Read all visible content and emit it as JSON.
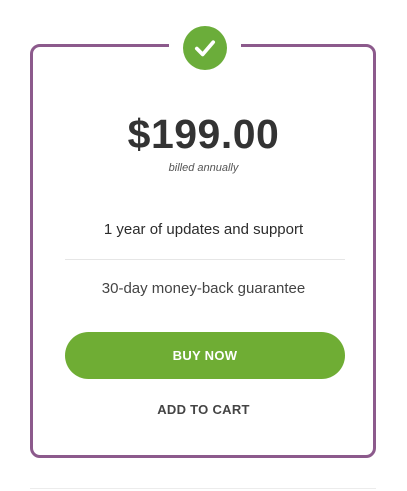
{
  "pricing": {
    "price": "$199.00",
    "billing_note": "billed annually",
    "features": [
      "1 year of updates and support",
      "30-day money-back guarantee"
    ],
    "buy_label": "BUY NOW",
    "cart_label": "ADD TO CART",
    "icon": "checkmark-icon"
  },
  "colors": {
    "card_border": "#8c5a8c",
    "accent_green": "#6fad34",
    "text_dark": "#333333"
  }
}
